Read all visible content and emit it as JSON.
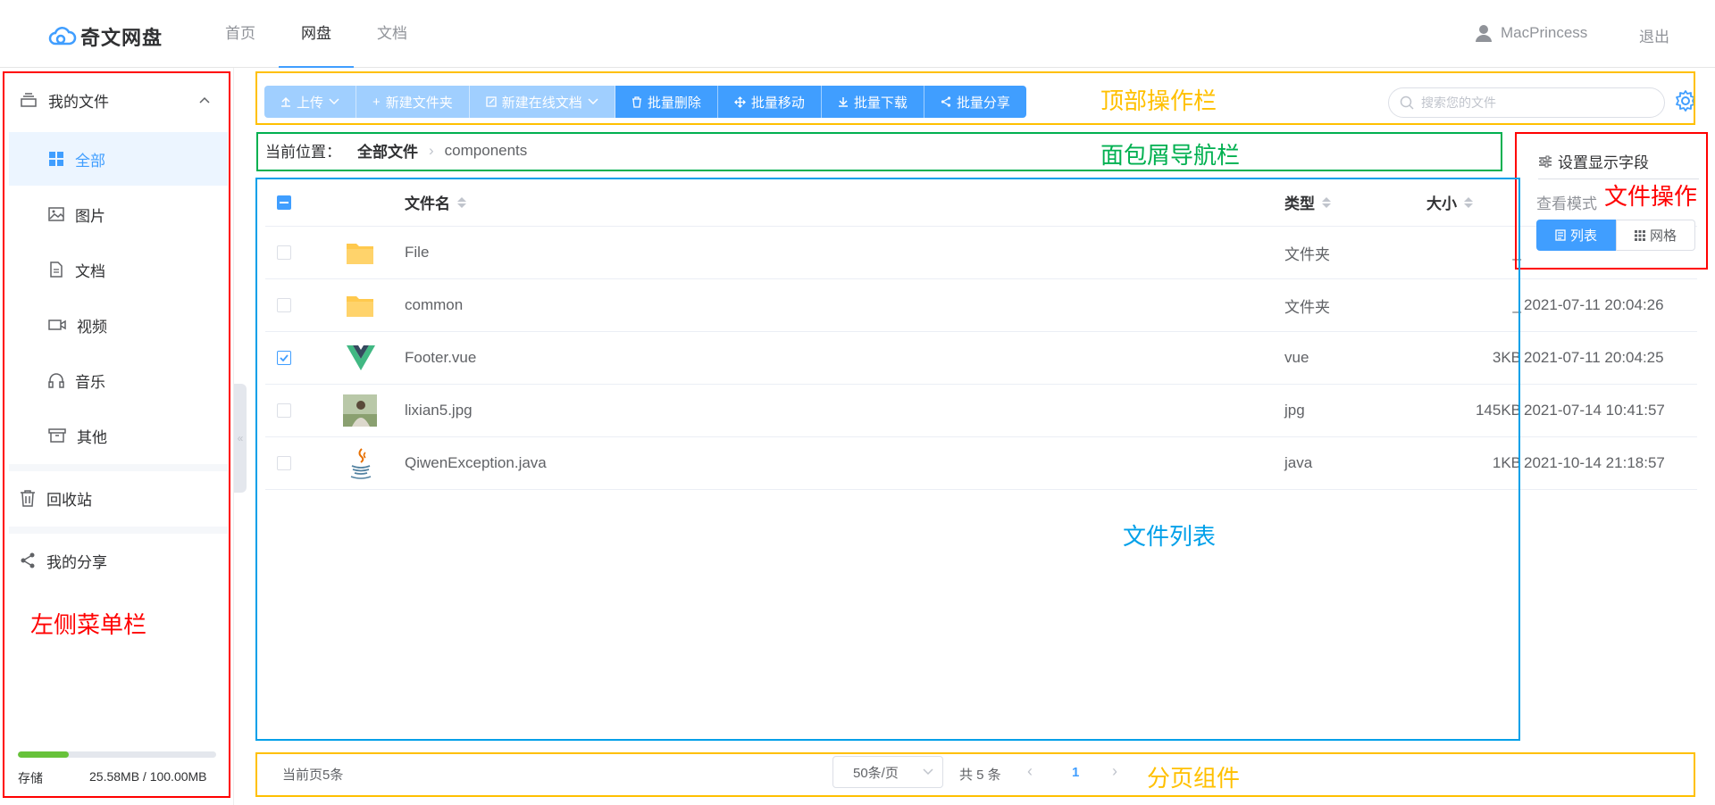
{
  "header": {
    "logo_text": "奇文网盘",
    "nav": [
      "首页",
      "网盘",
      "文档"
    ],
    "active_nav": "网盘",
    "username": "MacPrincess",
    "logout": "退出"
  },
  "sidebar": {
    "my_files": "我的文件",
    "items": [
      {
        "label": "全部",
        "icon": "grid-icon"
      },
      {
        "label": "图片",
        "icon": "image-icon"
      },
      {
        "label": "文档",
        "icon": "document-icon"
      },
      {
        "label": "视频",
        "icon": "video-icon"
      },
      {
        "label": "音乐",
        "icon": "headphones-icon"
      },
      {
        "label": "其他",
        "icon": "archive-icon"
      }
    ],
    "recycle": "回收站",
    "share": "我的分享",
    "storage_label": "存储",
    "storage_value": "25.58MB / 100.00MB",
    "storage_fraction": 0.256
  },
  "toolbar": {
    "buttons": [
      {
        "label": "上传",
        "style": "light"
      },
      {
        "label": "新建文件夹",
        "style": "light"
      },
      {
        "label": "新建在线文档",
        "style": "light"
      },
      {
        "label": "批量删除",
        "style": "solid"
      },
      {
        "label": "批量移动",
        "style": "solid"
      },
      {
        "label": "批量下载",
        "style": "solid"
      },
      {
        "label": "批量分享",
        "style": "solid"
      }
    ],
    "search_placeholder": "搜索您的文件"
  },
  "breadcrumb": {
    "label": "当前位置：",
    "root": "全部文件",
    "current": "components"
  },
  "table": {
    "headers": {
      "name": "文件名",
      "type": "类型",
      "size": "大小"
    },
    "rows": [
      {
        "name": "File",
        "type": "文件夹",
        "size": "_",
        "date": "",
        "checked": false,
        "icon": "folder-icon"
      },
      {
        "name": "common",
        "type": "文件夹",
        "size": "_",
        "date": "2021-07-11 20:04:26",
        "checked": false,
        "icon": "folder-icon"
      },
      {
        "name": "Footer.vue",
        "type": "vue",
        "size": "3KB",
        "date": "2021-07-11 20:04:25",
        "checked": true,
        "icon": "vue-icon"
      },
      {
        "name": "lixian5.jpg",
        "type": "jpg",
        "size": "145KB",
        "date": "2021-07-14 10:41:57",
        "checked": false,
        "icon": "image-thumbnail-icon"
      },
      {
        "name": "QiwenException.java",
        "type": "java",
        "size": "1KB",
        "date": "2021-10-14 21:18:57",
        "checked": false,
        "icon": "java-icon"
      }
    ]
  },
  "right_panel": {
    "set_fields": "设置显示字段",
    "view_mode": "查看模式",
    "list": "列表",
    "grid": "网格"
  },
  "pagination": {
    "current_count": "当前页5条",
    "page_size": "50条/页",
    "total": "共 5 条",
    "page": "1"
  },
  "annotations": {
    "top_bar": "顶部操作栏",
    "breadcrumb": "面包屑导航栏",
    "file_ops": "文件操作",
    "file_list": "文件列表",
    "left_menu": "左侧菜单栏",
    "pagination": "分页组件"
  },
  "colors": {
    "primary": "#409eff",
    "primary_light": "#a0cfff",
    "red_annotation": "#ff0000",
    "yellow_annotation": "#ffc000",
    "green_annotation": "#00b050",
    "blue_annotation": "#00a0e9"
  }
}
